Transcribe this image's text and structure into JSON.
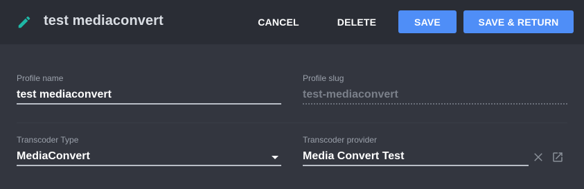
{
  "header": {
    "title": "test mediaconvert",
    "cancel_label": "CANCEL",
    "delete_label": "DELETE",
    "save_label": "SAVE",
    "save_return_label": "SAVE & RETURN",
    "edit_icon": "pencil-icon",
    "accent_color": "#1fb7a6",
    "primary_color": "#4f8ef7"
  },
  "form": {
    "profile_name": {
      "label": "Profile name",
      "value": "test mediaconvert"
    },
    "profile_slug": {
      "label": "Profile slug",
      "value": "test-mediaconvert"
    },
    "transcoder_type": {
      "label": "Transcoder Type",
      "value": "MediaConvert"
    },
    "transcoder_provider": {
      "label": "Transcoder provider",
      "value": "Media Convert Test",
      "clear_icon": "close-icon",
      "open_icon": "open-in-new-icon"
    }
  }
}
